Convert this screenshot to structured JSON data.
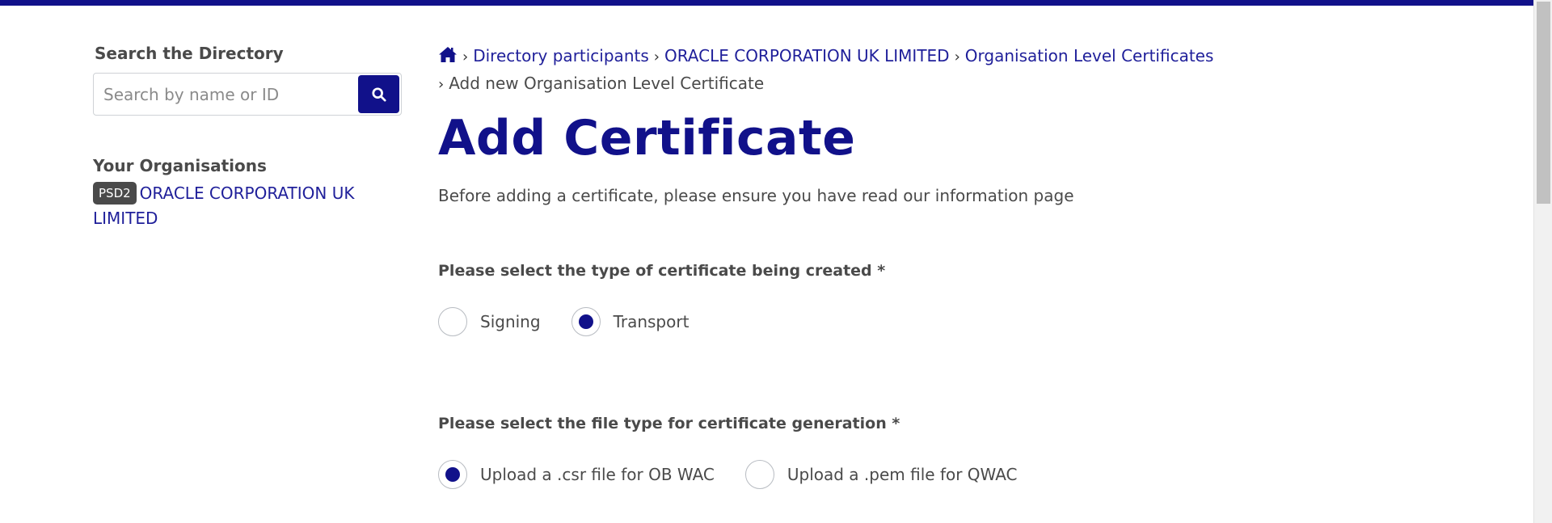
{
  "sidebar": {
    "search_heading": "Search the Directory",
    "search_placeholder": "Search by name or ID",
    "search_value": "",
    "orgs_heading": "Your Organisations",
    "org_badge": "PSD2",
    "org_name": "ORACLE CORPORATION UK LIMITED"
  },
  "breadcrumb": {
    "items": [
      "Directory participants",
      "ORACLE CORPORATION UK LIMITED",
      "Organisation Level Certificates"
    ],
    "current": "Add new Organisation Level Certificate"
  },
  "main": {
    "title": "Add Certificate",
    "intro": "Before adding a certificate, please ensure you have read our information page",
    "question1": {
      "label": "Please select the type of certificate being created *",
      "options": [
        "Signing",
        "Transport"
      ],
      "selected": "Transport"
    },
    "question2": {
      "label": "Please select the file type for certificate generation *",
      "options": [
        "Upload a .csr file for OB WAC",
        "Upload a .pem file for QWAC"
      ],
      "selected": "Upload a .csr file for OB WAC"
    }
  },
  "colors": {
    "brand": "#11118a",
    "link": "#1f1f9a",
    "text": "#4a4a4a"
  },
  "icons": {
    "search": "search-icon",
    "home": "home-icon",
    "separator": "chevron-right-icon"
  }
}
